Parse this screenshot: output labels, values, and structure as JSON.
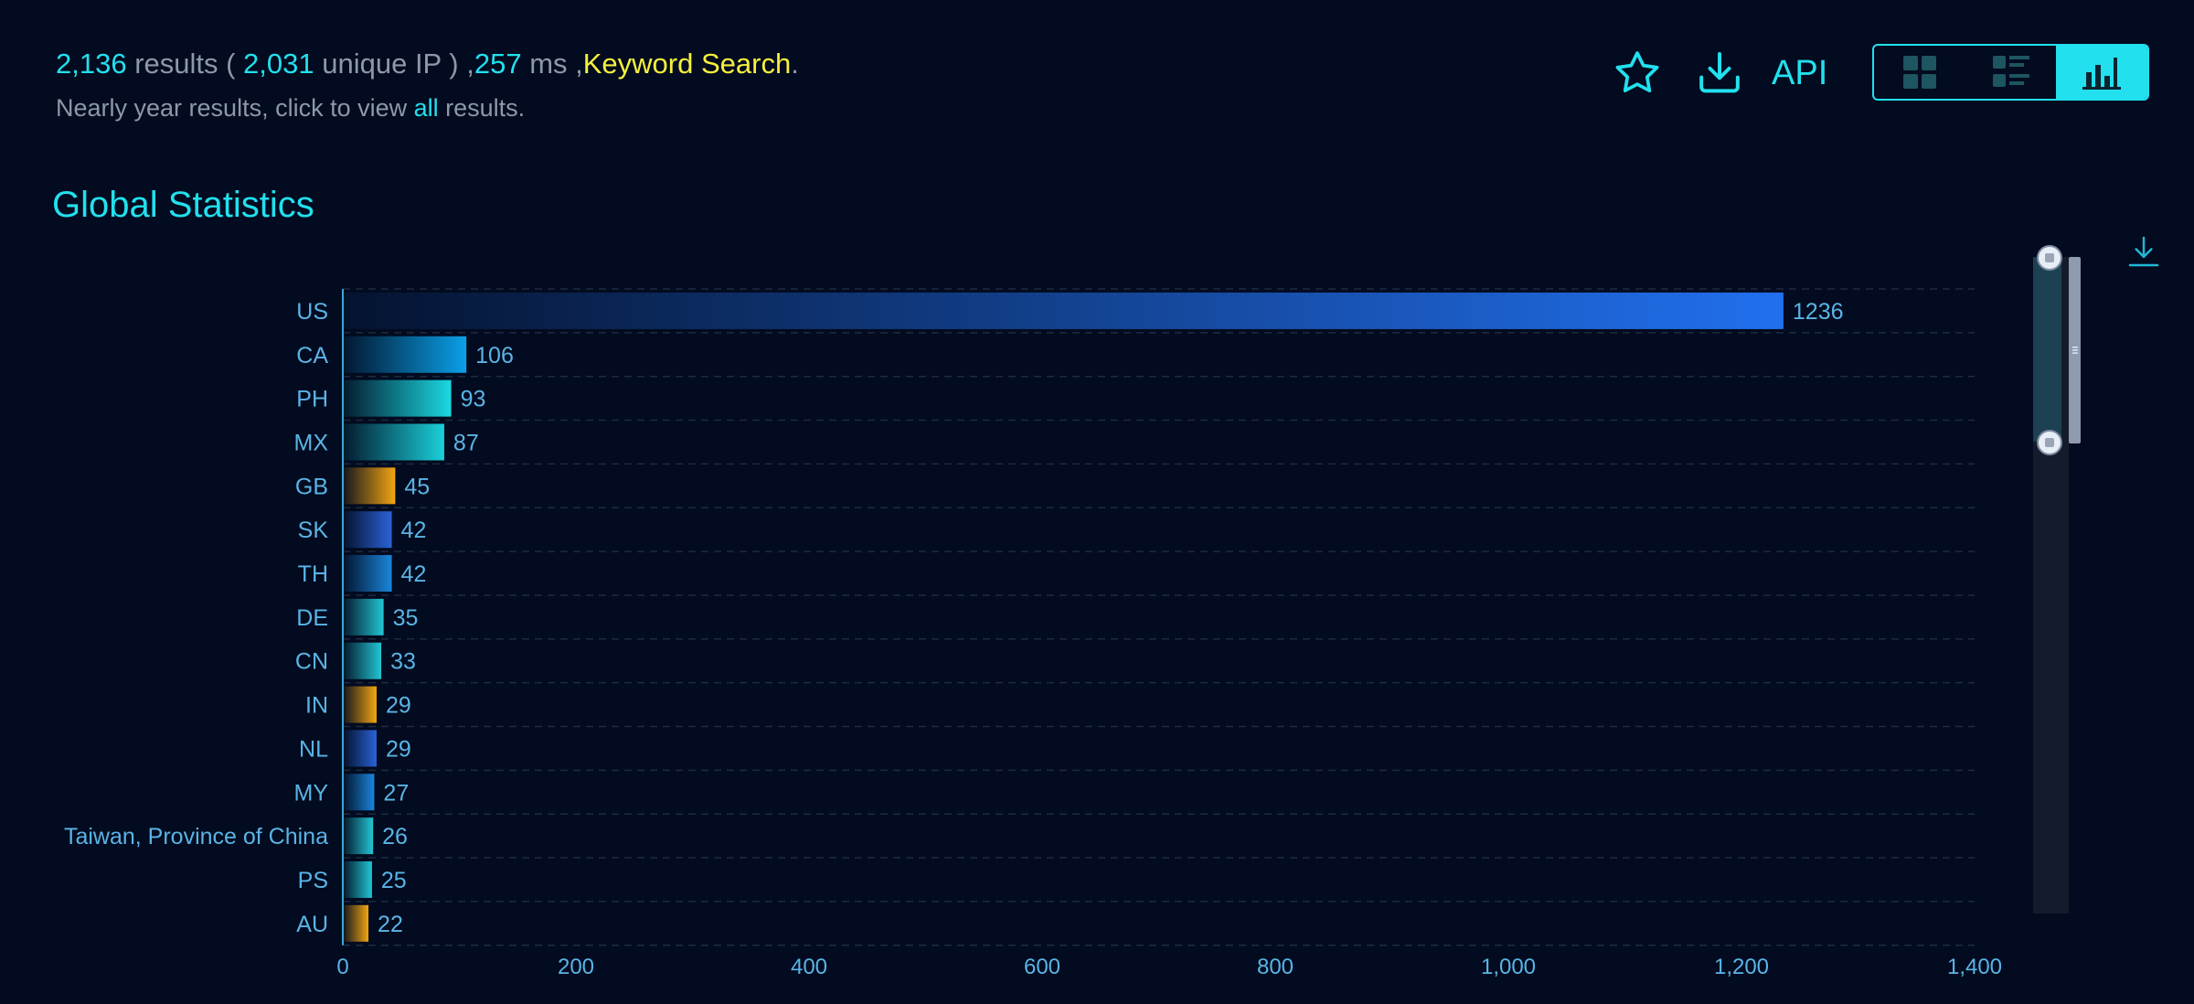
{
  "summary": {
    "result_count": "2,136",
    "results_word": " results ( ",
    "unique_ip_count": "2,031",
    "unique_ip_word": " unique IP ) ,",
    "time_ms": "257",
    "ms_word": " ms ,",
    "search_type": "Keyword Search",
    "period": "."
  },
  "subline": {
    "prefix": "Nearly year results, click to view ",
    "link": "all",
    "suffix": " results."
  },
  "toolbar": {
    "api_label": "API",
    "favorite_icon": "star-icon",
    "download_icon": "download-icon",
    "views": [
      "grid-view-icon",
      "list-view-icon",
      "chart-view-icon"
    ],
    "active_view": 2
  },
  "section": {
    "title": "Global Statistics"
  },
  "colors": {
    "accent": "#22e0ee",
    "keyword": "#f5f03c",
    "label": "#5ab4e6",
    "background": "#020b1f"
  },
  "chart_data": {
    "type": "bar",
    "orientation": "horizontal",
    "categories": [
      "US",
      "CA",
      "PH",
      "MX",
      "GB",
      "SK",
      "TH",
      "DE",
      "CN",
      "IN",
      "NL",
      "MY",
      "Taiwan, Province of China",
      "PS",
      "AU"
    ],
    "values": [
      1236,
      106,
      93,
      87,
      45,
      42,
      42,
      35,
      33,
      29,
      29,
      27,
      26,
      25,
      22
    ],
    "bar_colors": [
      "#2170ee",
      "#0aa0e8",
      "#1ad9e2",
      "#1ad0da",
      "#f2a512",
      "#2a63d8",
      "#1a86dc",
      "#22c6d4",
      "#22c6d4",
      "#f2a512",
      "#2a63d8",
      "#1a86dc",
      "#22c6d4",
      "#22c6d4",
      "#f2a512"
    ],
    "xlim": [
      0,
      1400
    ],
    "x_ticks": [
      "0",
      "200",
      "400",
      "600",
      "800",
      "1,000",
      "1,200",
      "1,400"
    ],
    "data_labels": true,
    "grid": "horizontal dashed"
  }
}
